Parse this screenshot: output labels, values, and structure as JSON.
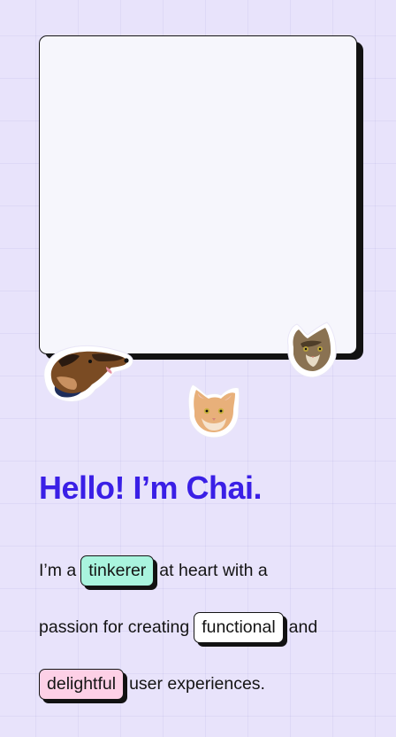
{
  "hero": {
    "heading": "Hello! I’m Chai."
  },
  "intro": {
    "line1_prefix": "I’m a",
    "line1_chip": "tinkerer",
    "line1_suffix": "at heart with a",
    "line2_prefix": "passion for creating",
    "line2_chip": "functional",
    "line2_suffix": "and",
    "line3_chip": "delightful",
    "line3_suffix": "user experiences."
  },
  "colors": {
    "background": "#e8e3fb",
    "heading": "#3a1fe6",
    "chip_tinkerer": "#a9f4de",
    "chip_functional": "#ffffff",
    "chip_delightful": "#fdd0e6",
    "outline": "#151515"
  },
  "stickers": [
    "dog-sticker",
    "cat-sticker-tabby",
    "cat-sticker-orange"
  ]
}
